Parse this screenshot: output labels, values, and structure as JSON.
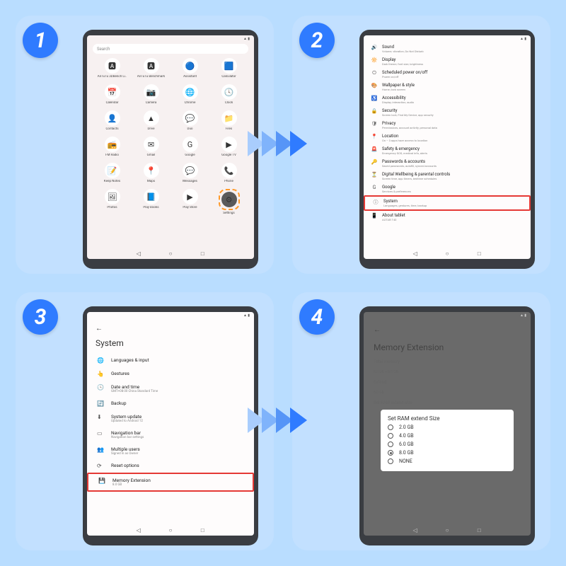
{
  "steps": [
    "1",
    "2",
    "3",
    "4"
  ],
  "search": {
    "placeholder": "Search"
  },
  "apps": {
    "row0": [
      {
        "label": "AnTuTu 3DBench Li..",
        "bg": "#fff",
        "glyph": "🅰"
      },
      {
        "label": "AnTuTu Benchmark",
        "bg": "#fff",
        "glyph": "🅰"
      },
      {
        "label": "Assistant",
        "bg": "#fff",
        "glyph": "🔵"
      },
      {
        "label": "Calculator",
        "bg": "#fff",
        "glyph": "🟦"
      }
    ],
    "row1": [
      {
        "label": "Calendar",
        "bg": "#fff",
        "glyph": "📅"
      },
      {
        "label": "Camera",
        "bg": "#fff",
        "glyph": "📷"
      },
      {
        "label": "Chrome",
        "bg": "#fff",
        "glyph": "🌐"
      },
      {
        "label": "Clock",
        "bg": "#fff",
        "glyph": "🕓"
      }
    ],
    "row2": [
      {
        "label": "Contacts",
        "bg": "#fff",
        "glyph": "👤"
      },
      {
        "label": "Drive",
        "bg": "#fff",
        "glyph": "▲"
      },
      {
        "label": "Duo",
        "bg": "#fff",
        "glyph": "💬"
      },
      {
        "label": "Files",
        "bg": "#fff",
        "glyph": "📁"
      }
    ],
    "row3": [
      {
        "label": "FM Radio",
        "bg": "#fff",
        "glyph": "📻"
      },
      {
        "label": "Gmail",
        "bg": "#fff",
        "glyph": "✉"
      },
      {
        "label": "Google",
        "bg": "#fff",
        "glyph": "G"
      },
      {
        "label": "Google TV",
        "bg": "#fff",
        "glyph": "▶"
      }
    ],
    "row4": [
      {
        "label": "Keep Notes",
        "bg": "#fff",
        "glyph": "📝"
      },
      {
        "label": "Maps",
        "bg": "#fff",
        "glyph": "📍"
      },
      {
        "label": "Messages",
        "bg": "#fff",
        "glyph": "💬"
      },
      {
        "label": "Phone",
        "bg": "#fff",
        "glyph": "📞"
      }
    ],
    "row5": [
      {
        "label": "Photos",
        "bg": "#fff",
        "glyph": "🖼"
      },
      {
        "label": "Play Books",
        "bg": "#fff",
        "glyph": "📘"
      },
      {
        "label": "Play Store",
        "bg": "#fff",
        "glyph": "▶"
      },
      {
        "label": "Settings",
        "bg": "#5a5a5a",
        "glyph": "⚙",
        "highlight": true
      }
    ]
  },
  "nav": {
    "back": "◁",
    "home": "○",
    "recent": "□"
  },
  "settings": {
    "items": [
      {
        "icon": "🔊",
        "title": "Sound",
        "sub": "Volume, vibration, Do Not Disturb"
      },
      {
        "icon": "🔆",
        "title": "Display",
        "sub": "Dark theme, font size, brightness"
      },
      {
        "icon": "⏻",
        "title": "Scheduled power on/off",
        "sub": "Power on/off"
      },
      {
        "icon": "🎨",
        "title": "Wallpaper & style",
        "sub": "Home, lock screen"
      },
      {
        "icon": "♿",
        "title": "Accessibility",
        "sub": "Display, interaction, audio"
      },
      {
        "icon": "🔒",
        "title": "Security",
        "sub": "Screen lock, Find My Device, app security"
      },
      {
        "icon": "🛡",
        "title": "Privacy",
        "sub": "Permissions, account activity, personal data"
      },
      {
        "icon": "📍",
        "title": "Location",
        "sub": "On – 3 apps have access to location"
      },
      {
        "icon": "🚨",
        "title": "Safety & emergency",
        "sub": "Emergency SOS, medical info, alerts"
      },
      {
        "icon": "🔑",
        "title": "Passwords & accounts",
        "sub": "Saved passwords, autofill, synced accounts"
      },
      {
        "icon": "⏳",
        "title": "Digital Wellbeing & parental controls",
        "sub": "Screen time, app timers, bedtime schedules"
      },
      {
        "icon": "G",
        "title": "Google",
        "sub": "Services & preferences"
      },
      {
        "icon": "ⓘ",
        "title": "System",
        "sub": "Languages, gestures, time, backup",
        "highlight": true
      },
      {
        "icon": "📱",
        "title": "About tablet",
        "sub": "AOTAB T40"
      }
    ]
  },
  "system": {
    "back": "←",
    "title": "System",
    "items": [
      {
        "icon": "🌐",
        "title": "Languages & input",
        "sub": ""
      },
      {
        "icon": "👆",
        "title": "Gestures",
        "sub": ""
      },
      {
        "icon": "🕓",
        "title": "Date and time",
        "sub": "GMT+08:00 China Standard Time"
      },
      {
        "icon": "🔄",
        "title": "Backup",
        "sub": ""
      },
      {
        "icon": "⬇",
        "title": "System update",
        "sub": "Updated to Android 12"
      },
      {
        "icon": "▭",
        "title": "Navigation bar",
        "sub": "Navigation bar settings"
      },
      {
        "icon": "👥",
        "title": "Multiple users",
        "sub": "Signed in as Owner"
      },
      {
        "icon": "⟳",
        "title": "Reset options",
        "sub": ""
      },
      {
        "icon": "💾",
        "title": "Memory Extension",
        "sub": "8.0 GB",
        "highlight": true
      }
    ]
  },
  "memext": {
    "back": "←",
    "title": "Memory Extension",
    "total_lbl": "Total memory",
    "total_val": "8.0 GB + 8.0 GB",
    "extend_lbl": "Extend",
    "extend_val": "8.0 GB",
    "ram_hdr": "Set RAM extend size",
    "dialog_title": "Set RAM extend Size",
    "options": [
      {
        "label": "2.0 GB",
        "sel": false
      },
      {
        "label": "4.0 GB",
        "sel": false
      },
      {
        "label": "6.0 GB",
        "sel": false
      },
      {
        "label": "8.0 GB",
        "sel": true
      },
      {
        "label": "NONE",
        "sel": false
      }
    ]
  }
}
